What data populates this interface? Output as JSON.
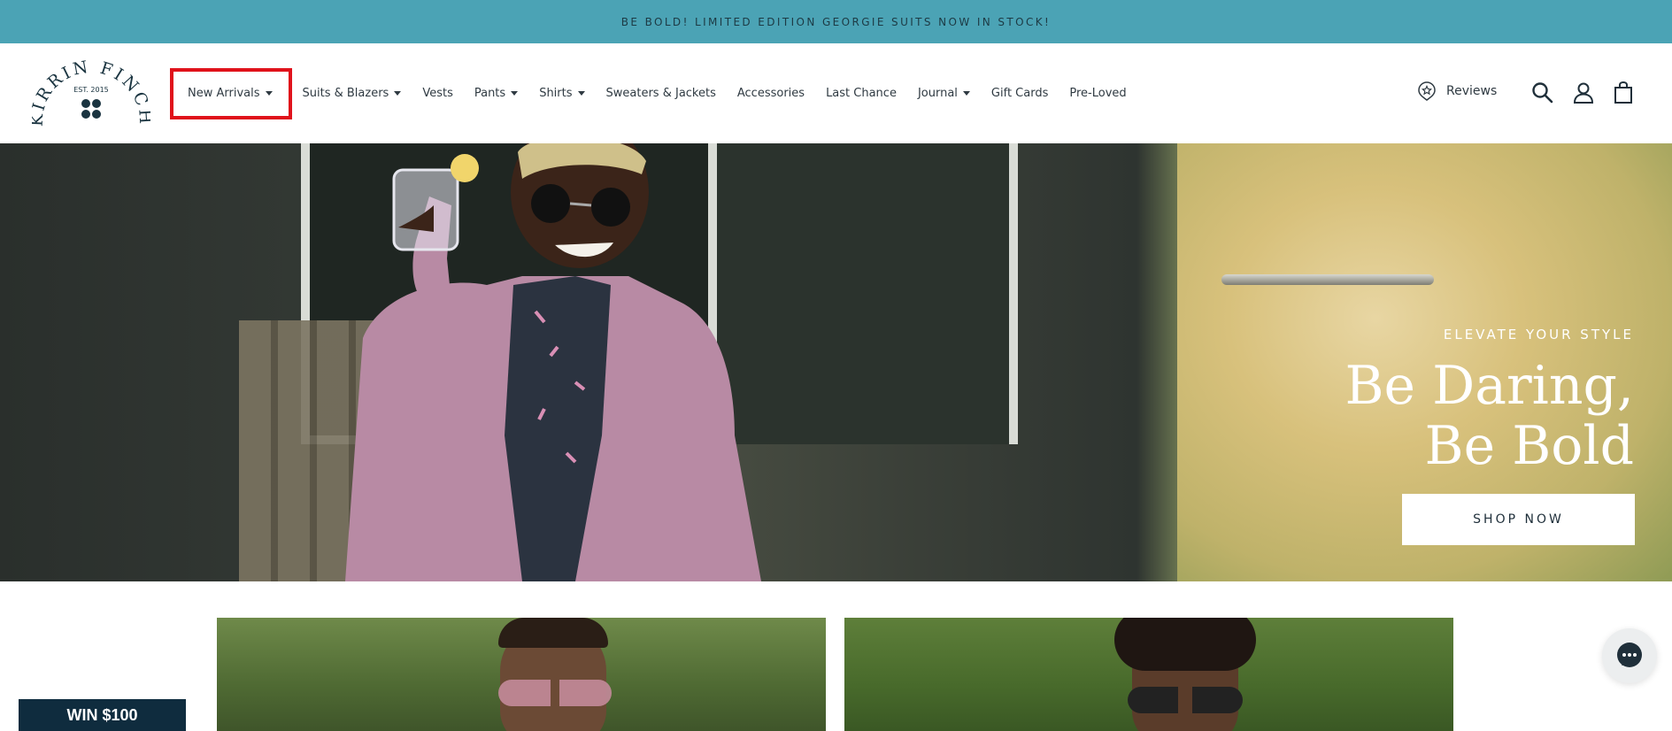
{
  "announcement": {
    "text": "BE BOLD! LIMITED EDITION GEORGIE SUITS NOW IN STOCK!"
  },
  "brand": {
    "name_top": "KIRRIN FINCH",
    "est": "EST. 2015"
  },
  "nav": {
    "items": [
      {
        "label": "New Arrivals",
        "dropdown": true,
        "highlighted": true
      },
      {
        "label": "Suits & Blazers",
        "dropdown": true
      },
      {
        "label": "Vests",
        "dropdown": false
      },
      {
        "label": "Pants",
        "dropdown": true
      },
      {
        "label": "Shirts",
        "dropdown": true
      },
      {
        "label": "Sweaters & Jackets",
        "dropdown": false
      },
      {
        "label": "Accessories",
        "dropdown": false
      },
      {
        "label": "Last Chance",
        "dropdown": false
      },
      {
        "label": "Journal",
        "dropdown": true
      },
      {
        "label": "Gift Cards",
        "dropdown": false
      },
      {
        "label": "Pre-Loved",
        "dropdown": false
      }
    ]
  },
  "header_actions": {
    "reviews_label": "Reviews",
    "icons": [
      "search-icon",
      "account-icon",
      "cart-icon"
    ]
  },
  "hero": {
    "eyebrow": "ELEVATE YOUR STYLE",
    "headline": "Be Daring, Be Bold",
    "cta": "SHOP NOW"
  },
  "promo_badge": {
    "text": "WIN $100"
  },
  "colors": {
    "announcement_bg": "#4ba3b5",
    "highlight_outline": "#e0121b",
    "badge_bg": "#0f2c3e"
  }
}
